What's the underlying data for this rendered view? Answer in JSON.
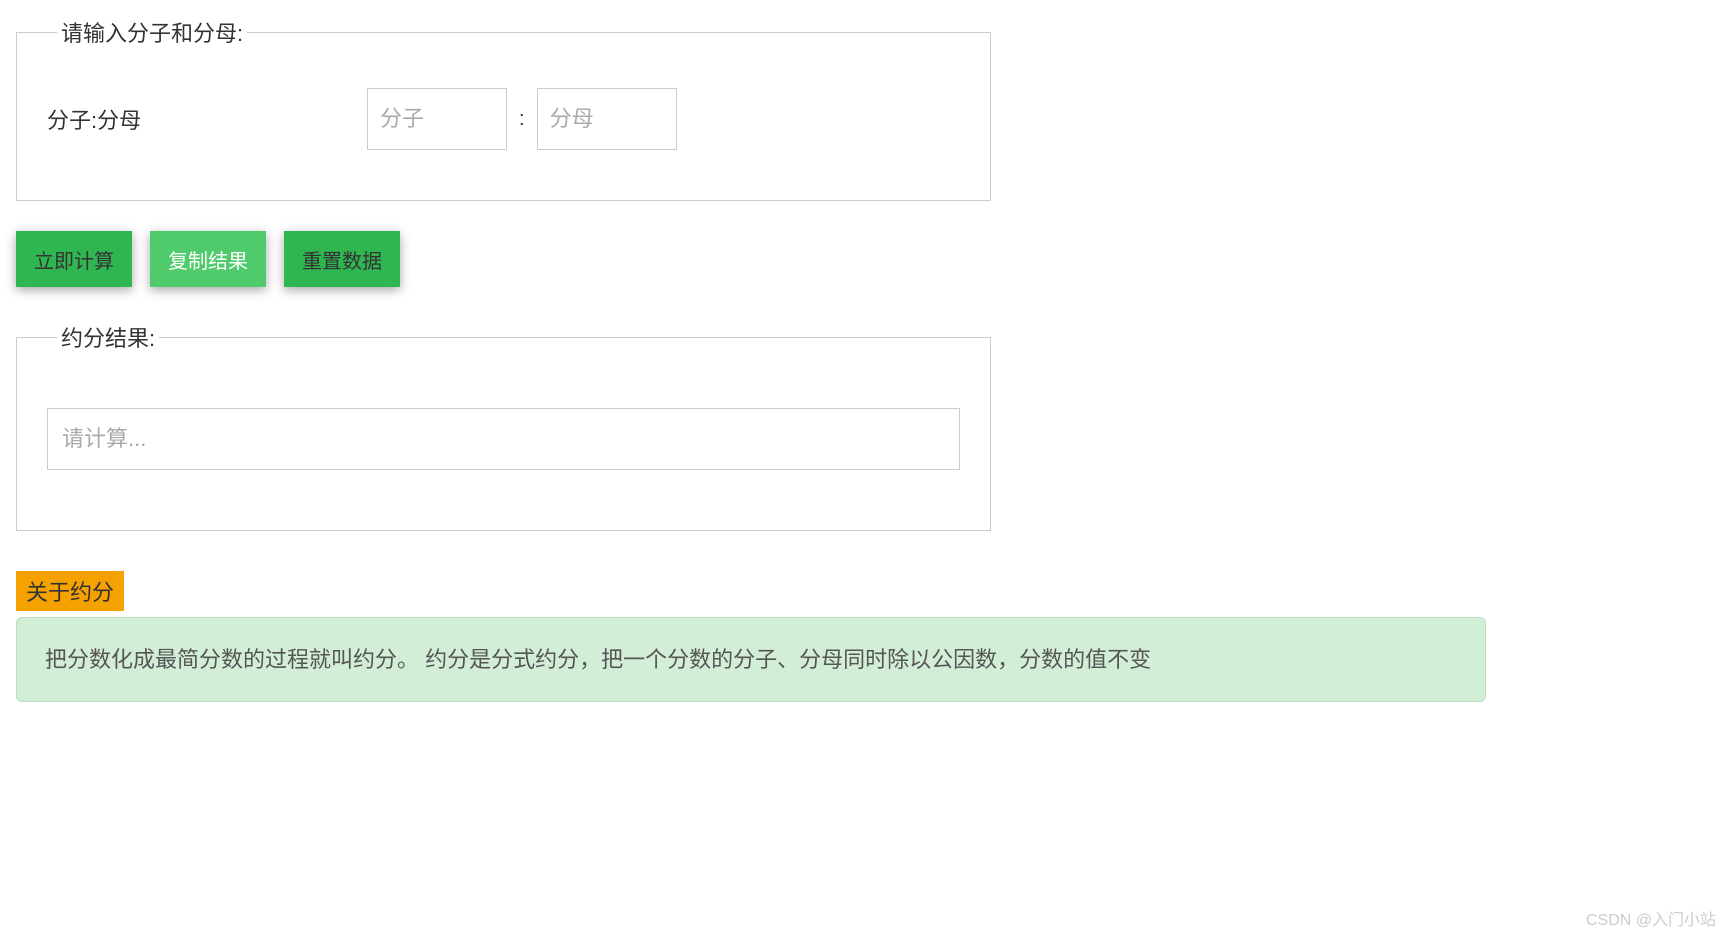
{
  "inputSection": {
    "legend": "请输入分子和分母:",
    "rowLabel": "分子:分母",
    "numeratorPlaceholder": "分子",
    "separator": ":",
    "denominatorPlaceholder": "分母"
  },
  "buttons": {
    "calculate": "立即计算",
    "copy": "复制结果",
    "reset": "重置数据"
  },
  "resultSection": {
    "legend": "约分结果:",
    "placeholder": "请计算..."
  },
  "about": {
    "label": "关于约分",
    "text": "把分数化成最简分数的过程就叫约分。 约分是分式约分，把一个分数的分子、分母同时除以公因数，分数的值不变"
  },
  "watermark": "CSDN @入门小站"
}
